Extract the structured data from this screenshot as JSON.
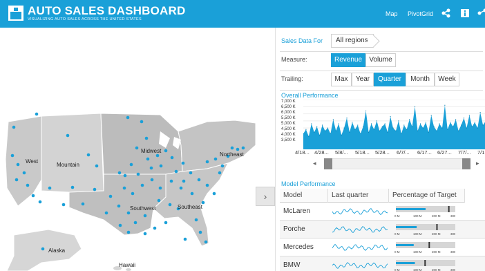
{
  "header": {
    "title": "AUTO SALES DASHBOARD",
    "subtitle": "VISUALIZING AUTO SALES ACROSS THE UNITED STATES",
    "nav": [
      "Map",
      "PivotGrid"
    ],
    "icons": [
      "share-nodes-icon",
      "info-icon",
      "share-icon"
    ],
    "accent_color": "#1aa0d8"
  },
  "map": {
    "region_labels": [
      "West",
      "Mountain",
      "Midwest",
      "Northeast",
      "Southwest",
      "Southeast",
      "Alaska",
      "Hawaii"
    ],
    "dot_color": "#1aa0d8",
    "collapse_glyph": "›"
  },
  "panel": {
    "sales_data_label": "Sales Data For",
    "region_value": "All regions",
    "measure_label": "Measure:",
    "measure_options": [
      "Revenue",
      "Volume"
    ],
    "measure_selected": "Revenue",
    "trailing_label": "Trailing:",
    "trailing_options": [
      "Max",
      "Year",
      "Quarter",
      "Month",
      "Week"
    ],
    "trailing_selected": "Quarter"
  },
  "overall": {
    "title": "Overall Performance",
    "y_ticks": [
      "7,000 K",
      "6,500 K",
      "6,000 K",
      "5,500 K",
      "5,000 K",
      "4,500 K",
      "4,000 K",
      "3,500 K"
    ],
    "x_ticks": [
      "4/18...",
      "4/28...",
      "5/8/...",
      "5/18...",
      "5/28...",
      "6/7/...",
      "6/17...",
      "6/27...",
      "7/7/...",
      "7/1"
    ]
  },
  "chart_data": {
    "type": "area",
    "title": "Overall Performance",
    "ylim": [
      3500,
      7000
    ],
    "ylabel": "",
    "xlabel": "",
    "y_unit": "K",
    "values": [
      4600,
      4900,
      4400,
      5300,
      4700,
      5100,
      4500,
      5200,
      4800,
      5000,
      4600,
      5600,
      4800,
      5300,
      4500,
      5000,
      5700,
      4700,
      5400,
      4900,
      5200,
      4600,
      5100,
      6200,
      4700,
      5300,
      4900,
      5500,
      4800,
      5100,
      5300,
      4700,
      5800,
      5000,
      4800,
      5500,
      4600,
      5200,
      4900,
      5600,
      5100,
      6500,
      4800,
      5300,
      5000,
      5400,
      4700,
      5900,
      5100,
      4800,
      5300,
      5000,
      6600,
      4900,
      5400,
      5100,
      5600,
      4800,
      5200,
      5700,
      5000,
      5900,
      5100,
      5400,
      5000,
      6100,
      5200,
      5500
    ]
  },
  "model": {
    "title": "Model Performance",
    "headers": [
      "Model",
      "Last quarter",
      "Percentage of Target"
    ],
    "scale_labels": [
      "0 M",
      "100 M",
      "200 M",
      "300 M"
    ],
    "rows": [
      {
        "name": "McLaren",
        "actual": 0.5,
        "target": 0.88
      },
      {
        "name": "Porche",
        "actual": 0.35,
        "target": 0.68
      },
      {
        "name": "Mercedes",
        "actual": 0.3,
        "target": 0.55
      },
      {
        "name": "BMW",
        "actual": 0.32,
        "target": 0.48
      }
    ]
  }
}
